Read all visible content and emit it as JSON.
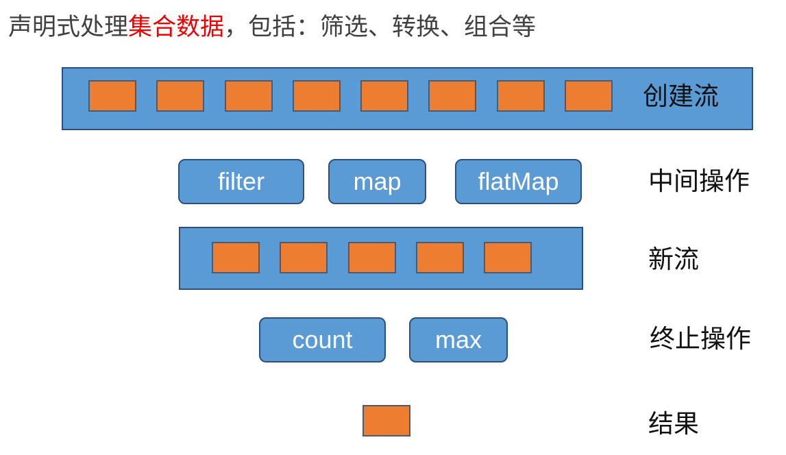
{
  "headline": {
    "part1": "声明式处理",
    "highlight": "集合数据",
    "part2": "，包括：筛选、转换、组合等",
    "highlight_color": "#ee0000"
  },
  "stages": {
    "create": "创建流",
    "intermediate": "中间操作",
    "new_stream": "新流",
    "terminal": "终止操作",
    "result": "结果"
  },
  "intermediate_ops": [
    "filter",
    "map",
    "flatMap"
  ],
  "terminal_ops": [
    "count",
    "max"
  ],
  "colors": {
    "stream": "#5b9bd5",
    "element": "#ed7d31"
  }
}
